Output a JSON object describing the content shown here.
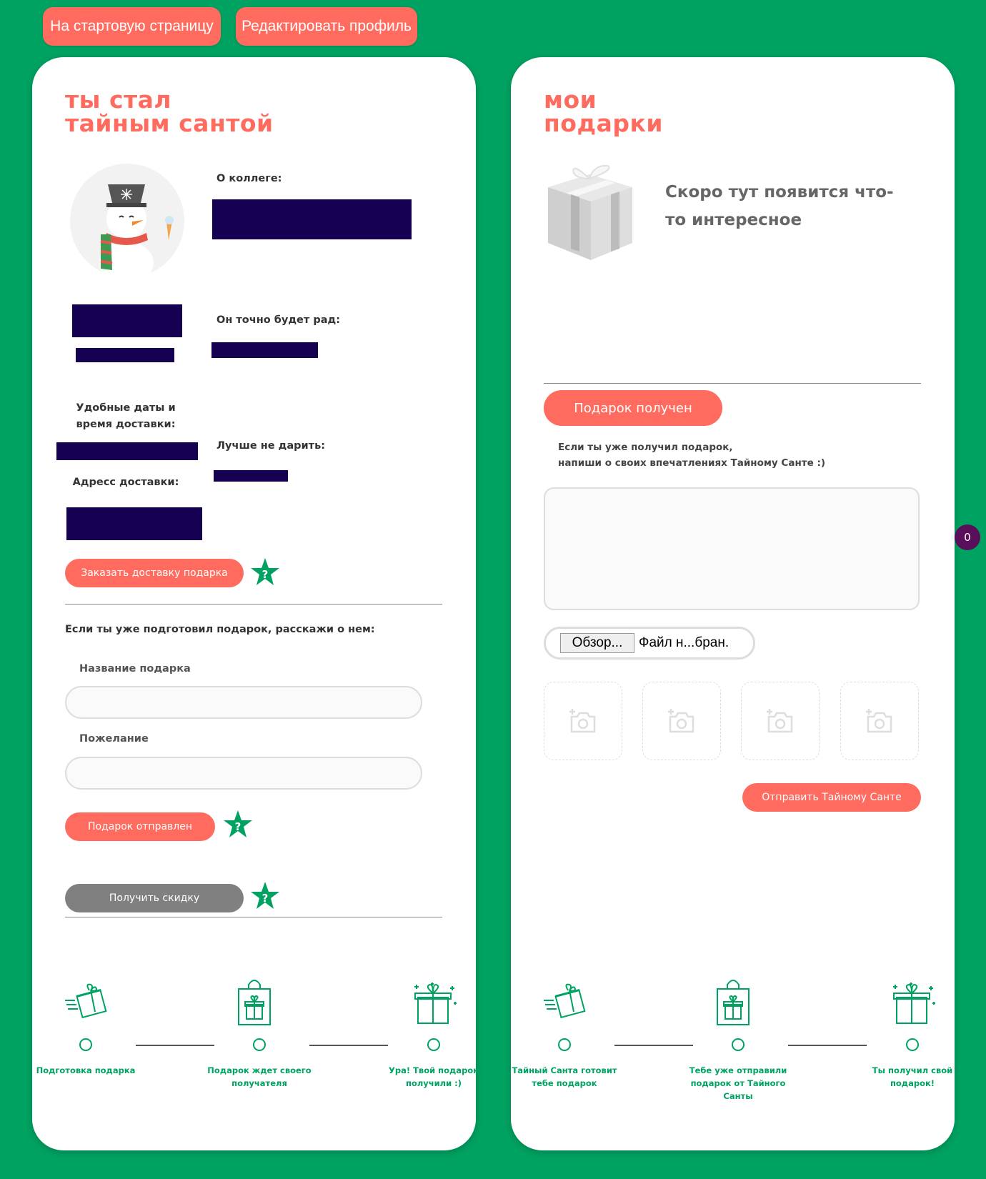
{
  "nav": {
    "home_label": "На стартовую страницу",
    "edit_profile_label": "Редактировать профиль"
  },
  "santa": {
    "title_line1": "ты стал",
    "title_line2": "тайным сантой",
    "about_colleague_label": "О коллеге:",
    "will_be_glad_label": "Он точно будет рад:",
    "delivery_times_label": "Удобные даты и время доставки:",
    "better_not_label": "Лучше не дарить:",
    "address_label": "Адресс доставки:",
    "order_delivery_label": "Заказать доставку подарка",
    "prepared_prompt": "Если ты уже подготовил подарок, расскажи о нем:",
    "gift_name_label": "Название подарка",
    "wish_label": "Пожелание",
    "gift_sent_label": "Подарок отправлен",
    "get_discount_label": "Получить скидку",
    "help_symbol": "?",
    "steps": [
      "Подготовка подарка",
      "Подарок ждет своего получателя",
      "Ура! Твой подарок получили :)"
    ]
  },
  "gifts": {
    "title_line1": "мои",
    "title_line2": "подарки",
    "empty_text": "Скоро тут появится что-то интересное",
    "received_label": "Подарок получен",
    "feedback_prompt_line1": "Если ты уже получил подарок,",
    "feedback_prompt_line2": "напиши о своих впечатлениях Тайному Санте :)",
    "browse_label": "Обзор...",
    "file_status": "Файл н...бран.",
    "send_label": "Отправить Тайному Санте",
    "steps": [
      "Тайный Санта готовит тебе подарок",
      "Тебе уже отправили подарок от Тайного Санты",
      "Ты получил свой подарок!"
    ]
  },
  "badge_count": "0",
  "colors": {
    "background": "#00a261",
    "accent": "#ff6b5e",
    "redaction": "#150051",
    "badge": "#5a0f5a"
  }
}
